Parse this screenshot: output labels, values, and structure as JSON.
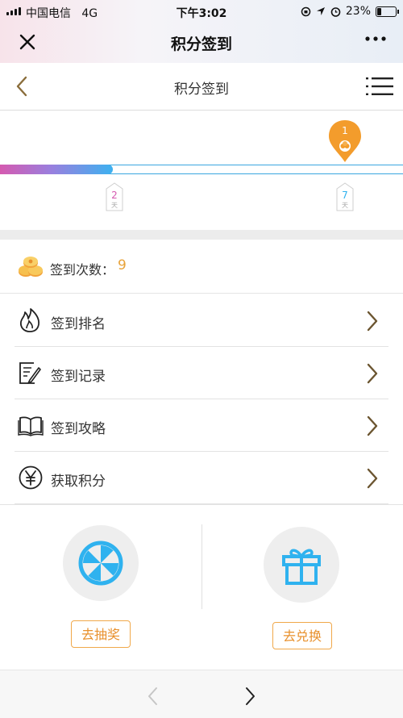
{
  "status_bar": {
    "carrier": "中国电信",
    "network": "4G",
    "time": "下午3:02",
    "battery": "23%"
  },
  "wechat_header": {
    "title": "积分签到"
  },
  "page_nav": {
    "title": "积分签到"
  },
  "progress": {
    "fill_fraction": 0.28,
    "milestones": [
      {
        "number": "2",
        "unit": "天"
      },
      {
        "number": "7",
        "unit": "天"
      }
    ],
    "current": "1"
  },
  "checkin": {
    "label": "签到次数：",
    "value": "9"
  },
  "menu": [
    {
      "label": "签到排名",
      "icon": "fire-icon"
    },
    {
      "label": "签到记录",
      "icon": "notepad-icon"
    },
    {
      "label": "签到攻略",
      "icon": "book-icon"
    },
    {
      "label": "获取积分",
      "icon": "yen-icon"
    }
  ],
  "actions": {
    "lottery_label": "去抽奖",
    "exchange_label": "去兑换"
  },
  "colors": {
    "accent_orange": "#f39c2c",
    "accent_blue": "#2fb2ef",
    "pink": "#d55ab0"
  }
}
